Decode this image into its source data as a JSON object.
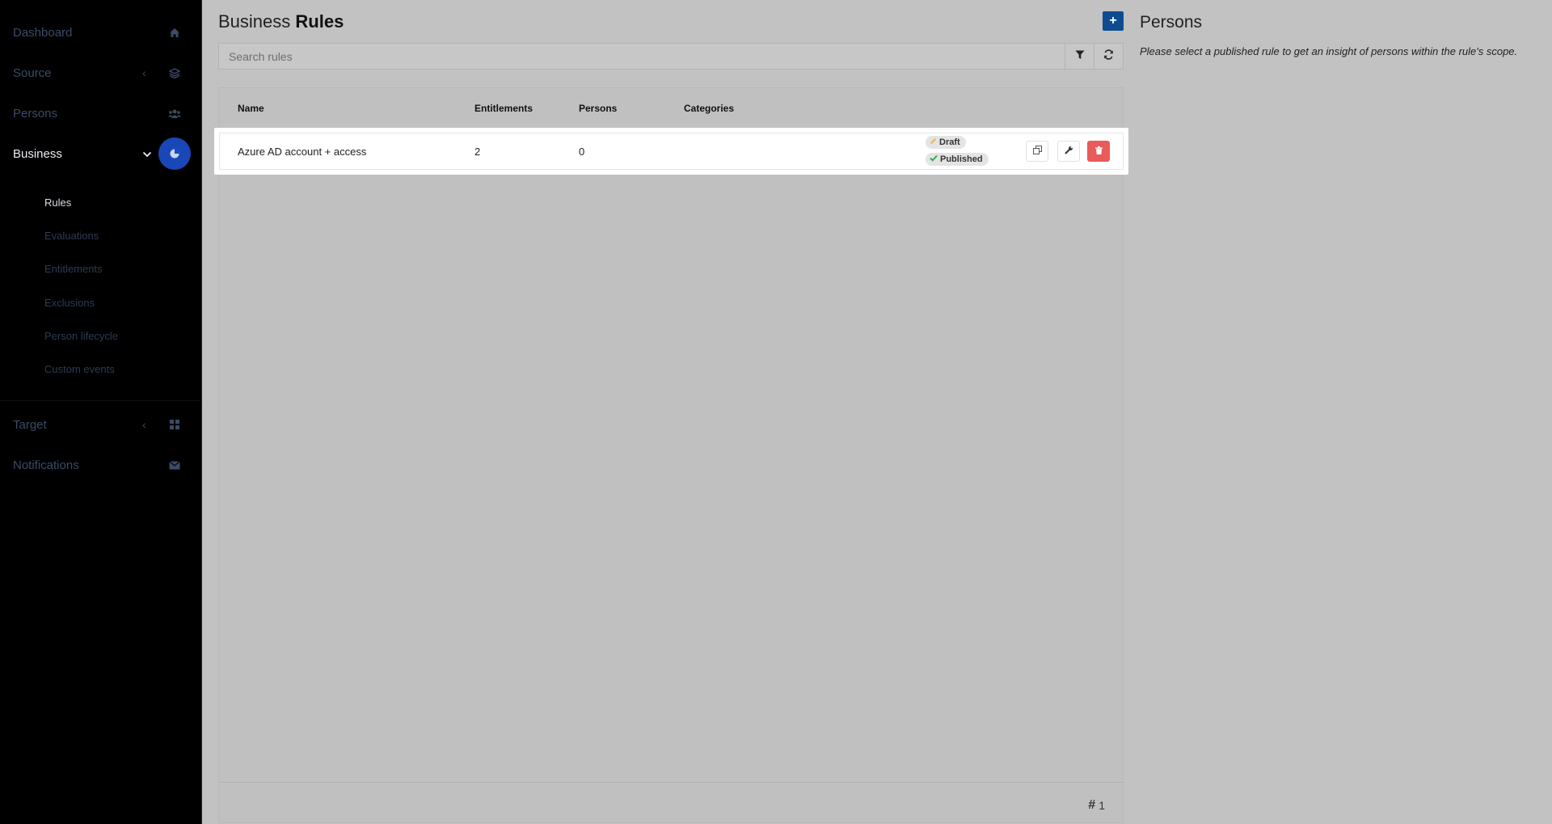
{
  "sidebar": {
    "items": [
      {
        "label": "Dashboard",
        "icon": "home-icon"
      },
      {
        "label": "Source",
        "icon": "layers-icon",
        "chevron": "‹"
      },
      {
        "label": "Persons",
        "icon": "users-icon"
      },
      {
        "label": "Business",
        "icon": "business-icon",
        "chevron": "⌄"
      },
      {
        "label": "Target",
        "icon": "grid-icon",
        "chevron": "‹"
      },
      {
        "label": "Notifications",
        "icon": "envelope-icon"
      }
    ],
    "sub_items": [
      "Rules",
      "Evaluations",
      "Entitlements",
      "Exclusions",
      "Person lifecycle",
      "Custom events"
    ]
  },
  "header": {
    "title_prefix": "Business",
    "title_bold": "Rules",
    "add_label": "+"
  },
  "search": {
    "placeholder": "Search rules"
  },
  "table": {
    "columns": [
      "Name",
      "Entitlements",
      "Persons",
      "Categories"
    ],
    "rows": [
      {
        "name": "Azure AD account + access",
        "entitlements": "2",
        "persons": "0",
        "categories": "",
        "badges": [
          "Draft",
          "Published"
        ]
      }
    ],
    "count_symbol": "#",
    "count": "1"
  },
  "persons_panel": {
    "title": "Persons",
    "description": "Please select a published rule to get an insight of persons within the rule's scope."
  },
  "colors": {
    "accent": "#1a47b8",
    "add_button": "#0f4c8f",
    "delete_button": "#ea5a5a",
    "published_check": "#2bb24c",
    "draft_pencil": "#e8b84a"
  }
}
